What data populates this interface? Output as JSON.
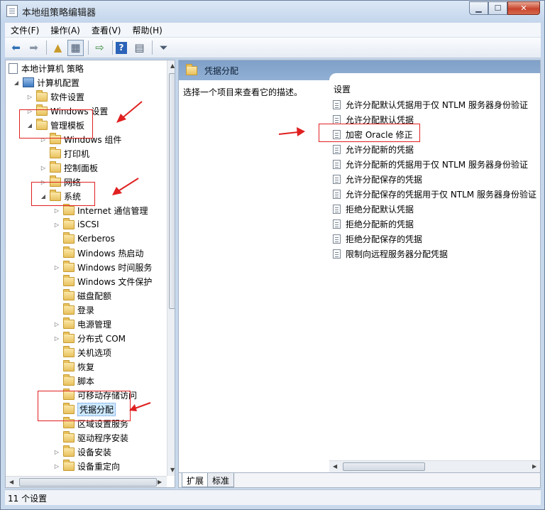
{
  "window": {
    "title": "本地组策略编辑器"
  },
  "menu": [
    "文件(F)",
    "操作(A)",
    "查看(V)",
    "帮助(H)"
  ],
  "tree": {
    "root": "本地计算机 策略",
    "computer_config": "计算机配置",
    "software_settings": "软件设置",
    "windows_settings": "Windows 设置",
    "admin_templates": "管理模板",
    "windows_components": "Windows 组件",
    "printers": "打印机",
    "control_panel": "控制面板",
    "network": "网络",
    "system": "系统",
    "system_children": [
      "Internet 通信管理",
      "iSCSI",
      "Kerberos",
      "Windows 热启动",
      "Windows 时间服务",
      "Windows 文件保护",
      "磁盘配额",
      "登录",
      "电源管理",
      "分布式 COM",
      "关机选项",
      "恢复",
      "脚本",
      "可移动存储访问",
      "凭据分配",
      "区域设置服务",
      "驱动程序安装",
      "设备安装",
      "设备重定向"
    ]
  },
  "right": {
    "header": "凭据分配",
    "description": "选择一个项目来查看它的描述。",
    "column": "设置",
    "items": [
      "允许分配默认凭据用于仅 NTLM 服务器身份验证",
      "允许分配默认凭据",
      "加密 Oracle 修正",
      "允许分配新的凭据",
      "允许分配新的凭据用于仅 NTLM 服务器身份验证",
      "允许分配保存的凭据",
      "允许分配保存的凭据用于仅 NTLM 服务器身份验证",
      "拒绝分配默认凭据",
      "拒绝分配新的凭据",
      "拒绝分配保存的凭据",
      "限制向远程服务器分配凭据"
    ]
  },
  "tabs": [
    "扩展",
    "标准"
  ],
  "status": "11 个设置",
  "colors": {
    "annotation": "#e02020",
    "header": "#8aa9cf"
  }
}
